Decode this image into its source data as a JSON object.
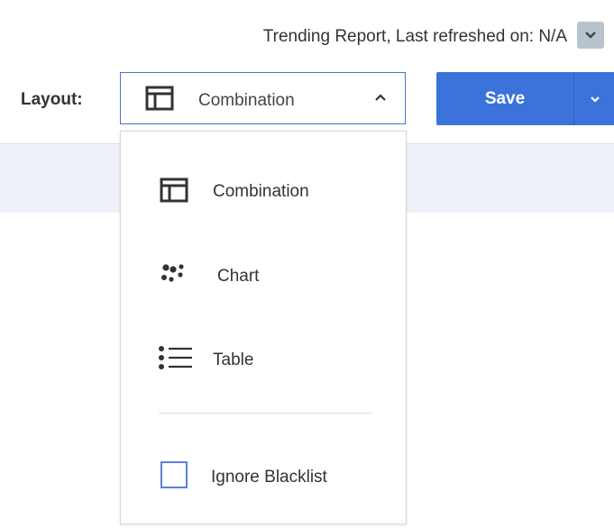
{
  "header": {
    "refresh_text": "Trending Report, Last refreshed on: N/A",
    "refresh_toggle_icon": "chevron-down-icon"
  },
  "toolbar": {
    "layout_label": "Layout:",
    "layout_selected": "Combination",
    "layout_icon": "combination-layout-icon",
    "layout_chevron_icon": "chevron-up-icon",
    "save_label": "Save",
    "save_dropdown_icon": "chevron-down-icon"
  },
  "layout_menu": {
    "items": [
      {
        "label": "Combination",
        "icon": "combination-layout-icon"
      },
      {
        "label": "Chart",
        "icon": "chart-dots-icon"
      },
      {
        "label": "Table",
        "icon": "list-icon"
      }
    ],
    "checkbox": {
      "label": "Ignore Blacklist",
      "checked": false
    }
  },
  "colors": {
    "accent": "#3b73db",
    "select_border": "#4b73c9",
    "band": "#eef2f8",
    "toggle_bg": "#b9c3cd"
  }
}
